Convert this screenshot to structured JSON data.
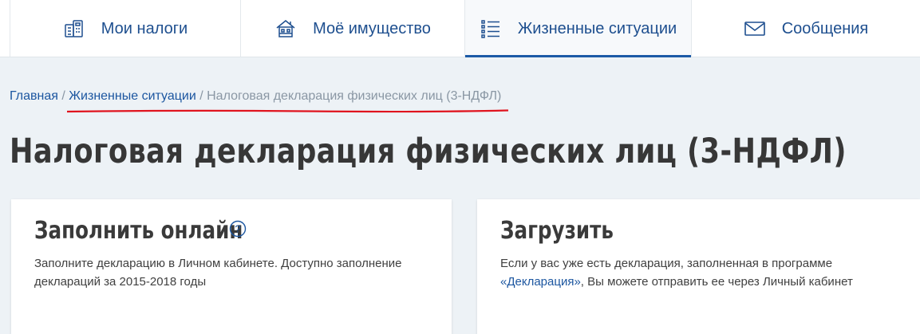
{
  "nav": {
    "items": [
      {
        "label": "Мои налоги",
        "icon": "calculator-documents-icon"
      },
      {
        "label": "Моё имущество",
        "icon": "house-icon"
      },
      {
        "label": "Жизненные ситуации",
        "icon": "checklist-icon",
        "active": true
      },
      {
        "label": "Сообщения",
        "icon": "envelope-icon"
      }
    ]
  },
  "breadcrumb": {
    "home": "Главная",
    "separator": "/",
    "section": "Жизненные ситуации",
    "current": "Налоговая декларация физических лиц (3-НДФЛ)"
  },
  "page": {
    "title": "Налоговая декларация физических лиц (3-НДФЛ)"
  },
  "cards": {
    "online": {
      "title": "Заполнить онлайн",
      "help_icon": "question-circle-icon",
      "text": "Заполните декларацию в Личном кабинете. Доступно заполнение деклараций за 2015-2018 годы"
    },
    "upload": {
      "title": "Загрузить",
      "text_before": "Если у вас уже есть декларация, заполненная в программе ",
      "link": "«Декларация»",
      "text_after": ", Вы можете отправить ее через Личный кабинет"
    }
  },
  "colors": {
    "accent": "#1c56a0",
    "annotation_underline": "#e0141e",
    "background": "#edf2f6"
  }
}
